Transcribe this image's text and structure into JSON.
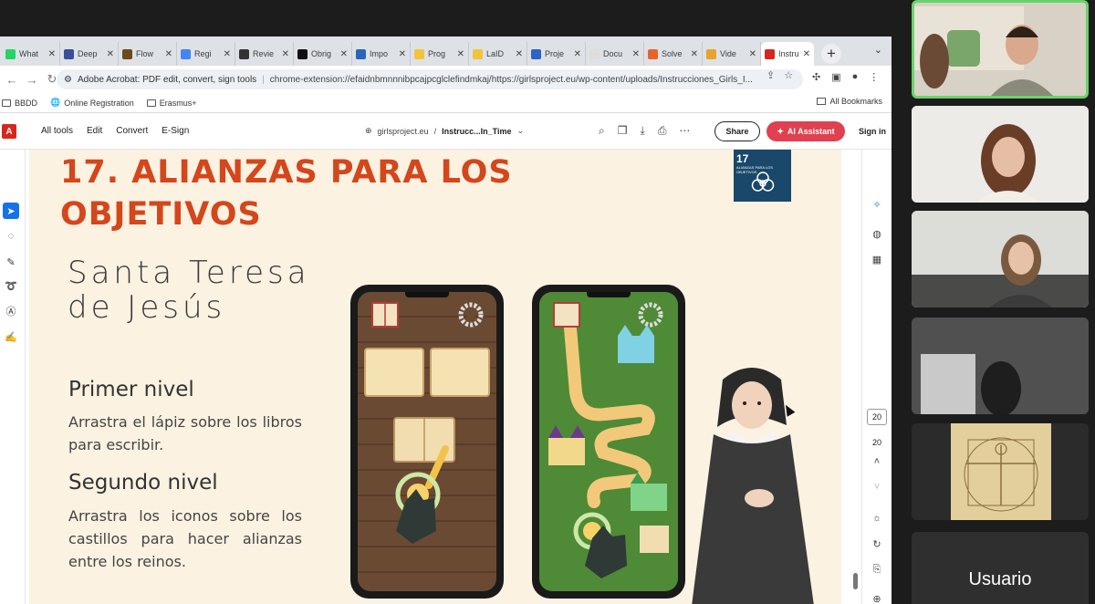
{
  "browser": {
    "tabs": [
      {
        "label": "What",
        "color": "#25d366"
      },
      {
        "label": "Deep",
        "color": "#3b4e9b"
      },
      {
        "label": "Flow",
        "color": "#6b4a1e"
      },
      {
        "label": "Regi",
        "color": "#4285f4"
      },
      {
        "label": "Revie",
        "color": "#333333"
      },
      {
        "label": "Obrig",
        "color": "#111111"
      },
      {
        "label": "Impo",
        "color": "#2a66b8"
      },
      {
        "label": "Prog",
        "color": "#f2c43a"
      },
      {
        "label": "LaID",
        "color": "#f2c43a"
      },
      {
        "label": "Proje",
        "color": "#2d62c8"
      },
      {
        "label": "Docu",
        "color": "#dddddd"
      },
      {
        "label": "Solve",
        "color": "#e8632b"
      },
      {
        "label": "Vide",
        "color": "#e8a32b"
      },
      {
        "label": "Instru",
        "color": "#d7261e"
      }
    ],
    "address": {
      "site_label": "Adobe Acrobat: PDF edit, convert, sign tools",
      "url": "chrome-extension://efaidnbmnnnibpcajpcglclefindmkaj/https://girlsproject.eu/wp-content/uploads/Instrucciones_Girls_I..."
    },
    "bookmarks": [
      "BBDD",
      "Online Registration",
      "Erasmus+"
    ],
    "all_bookmarks": "All Bookmarks"
  },
  "acrobat": {
    "logo": "A",
    "menu": [
      "All tools",
      "Edit",
      "Convert",
      "E-Sign"
    ],
    "domain": "girlsproject.eu",
    "separator": "/",
    "doc_name": "Instrucc...In_Time",
    "share": "Share",
    "ai_assistant": "AI Assistant",
    "sign_in": "Sign in",
    "page_current": "20",
    "page_total": "20"
  },
  "slide": {
    "title_line1": "17. ALIANZAS PARA LOS",
    "title_line2": "OBJETIVOS",
    "sdg_number": "17",
    "sdg_text": "ALIANZAS PARA LOS OBJETIVOS",
    "saint_line1": "Santa Teresa",
    "saint_line2": "de Jesús",
    "level1_title": "Primer nivel",
    "level1_text": "Arrastra el lápiz sobre los libros para escribir.",
    "level2_title": "Segundo nivel",
    "level2_text": "Arrastra los iconos sobre los castillos para hacer alianzas entre los reinos."
  },
  "call": {
    "user_label": "Usuario",
    "accent": "#69d36a"
  }
}
